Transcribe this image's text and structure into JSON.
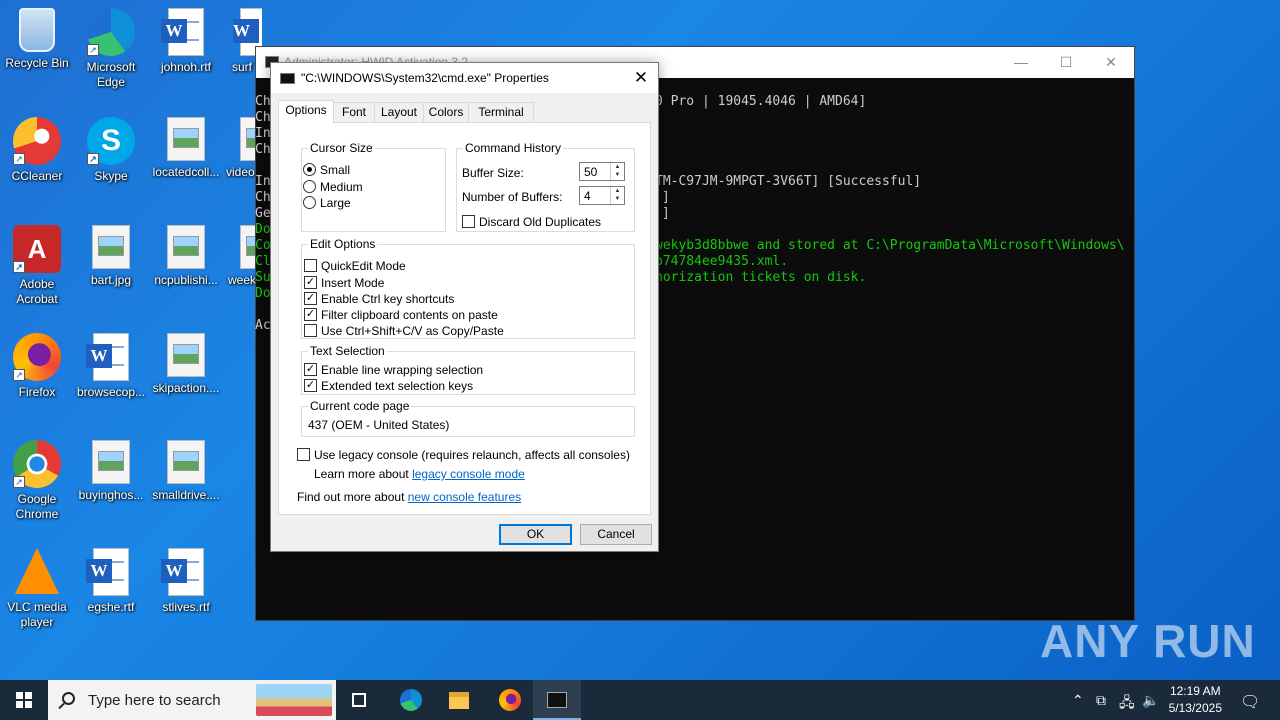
{
  "desktop": {
    "icons": [
      {
        "label": "Recycle Bin"
      },
      {
        "label": "Microsoft Edge"
      },
      {
        "label": "johnoh.rtf"
      },
      {
        "label": "surf"
      },
      {
        "label": "CCleaner"
      },
      {
        "label": "Skype"
      },
      {
        "label": "locatedcoll..."
      },
      {
        "label": "video"
      },
      {
        "label": "Adobe Acrobat"
      },
      {
        "label": "bart.jpg"
      },
      {
        "label": "ncpublishi..."
      },
      {
        "label": "week"
      },
      {
        "label": "Firefox"
      },
      {
        "label": "browsecop..."
      },
      {
        "label": "skipaction...."
      },
      {
        "label": "Google Chrome"
      },
      {
        "label": "buyinghos..."
      },
      {
        "label": "smalldrive...."
      },
      {
        "label": "VLC media player"
      },
      {
        "label": "egshe.rtf"
      },
      {
        "label": "stlives.rtf"
      }
    ]
  },
  "console": {
    "title": "Administrator:  HWID Activation 3.2",
    "lines": [
      {
        "prefix": "Ch",
        "text": "0 Pro | 19045.4046 | AMD64]"
      },
      {
        "prefix": "Ch",
        "text": ""
      },
      {
        "prefix": "In",
        "text": ""
      },
      {
        "prefix": "Ch",
        "text": ""
      },
      {
        "prefix": "In",
        "text": "TM-C97JM-9MPGT-3V66T] [Successful]"
      },
      {
        "prefix": "Ch",
        "text": "]"
      },
      {
        "prefix": "Ge",
        "text": "]"
      },
      {
        "prefix": "Do",
        "text": ""
      },
      {
        "prefix": "Co",
        "text": "wekyb3d8bbwe and stored at C:\\ProgramData\\Microsoft\\Windows\\"
      },
      {
        "prefix": "Cl",
        "text": "b74784ee9435.xml."
      },
      {
        "prefix": "Su",
        "text": "horization tickets on disk."
      },
      {
        "prefix": "Do",
        "text": ""
      },
      {
        "prefix": "Ac",
        "text": ""
      }
    ]
  },
  "dialog": {
    "title": "\"C:\\WINDOWS\\System32\\cmd.exe\" Properties",
    "tabs": [
      "Options",
      "Font",
      "Layout",
      "Colors",
      "Terminal"
    ],
    "cursor_size": {
      "legend": "Cursor Size",
      "options": [
        "Small",
        "Medium",
        "Large"
      ],
      "selected": "Small"
    },
    "command_history": {
      "legend": "Command History",
      "buffer_size_label": "Buffer Size:",
      "buffer_size_value": "50",
      "num_buffers_label": "Number of Buffers:",
      "num_buffers_value": "4",
      "discard_label": "Discard Old Duplicates",
      "discard_checked": false
    },
    "edit_options": {
      "legend": "Edit Options",
      "items": [
        {
          "label": "QuickEdit Mode",
          "checked": false
        },
        {
          "label": "Insert Mode",
          "checked": true
        },
        {
          "label": "Enable Ctrl key shortcuts",
          "checked": true
        },
        {
          "label": "Filter clipboard contents on paste",
          "checked": true
        },
        {
          "label": "Use Ctrl+Shift+C/V as Copy/Paste",
          "checked": false
        }
      ]
    },
    "text_selection": {
      "legend": "Text Selection",
      "items": [
        {
          "label": "Enable line wrapping selection",
          "checked": true
        },
        {
          "label": "Extended text selection keys",
          "checked": true
        }
      ]
    },
    "code_page": {
      "legend": "Current code page",
      "value": "437   (OEM - United States)"
    },
    "legacy": {
      "label": "Use legacy console (requires relaunch, affects all consoles)",
      "checked": false,
      "learn_prefix": "Learn more about ",
      "learn_link": "legacy console mode"
    },
    "find_more_prefix": "Find out more about ",
    "find_more_link": "new console features",
    "ok_label": "OK",
    "cancel_label": "Cancel"
  },
  "watermark": "ANY RUN",
  "taskbar": {
    "search_placeholder": "Type here to search",
    "time": "12:19 AM",
    "date": "5/13/2025"
  }
}
